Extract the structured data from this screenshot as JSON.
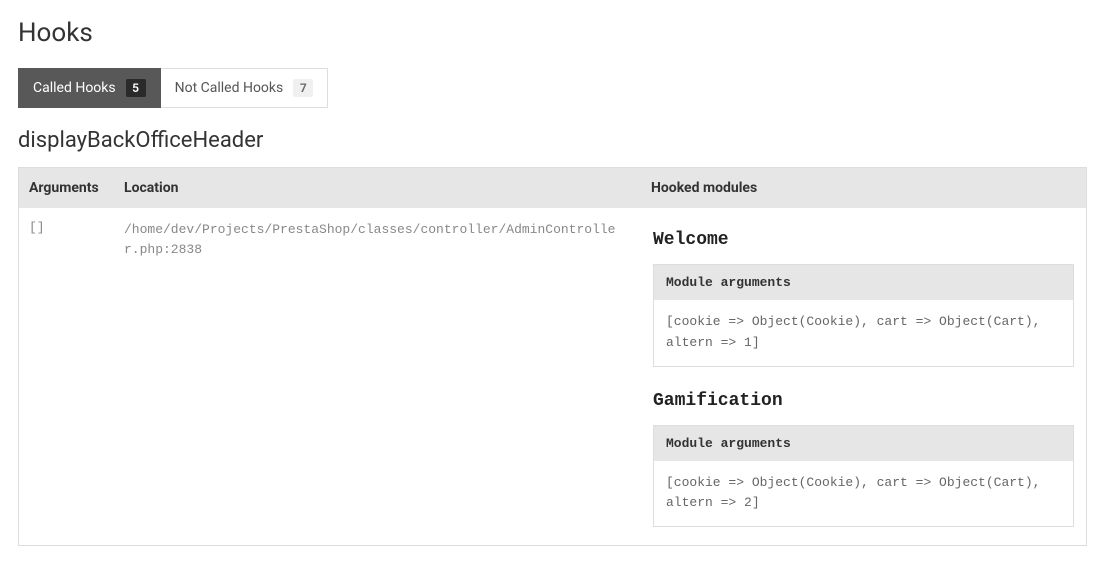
{
  "page_title": "Hooks",
  "tabs": [
    {
      "label": "Called Hooks",
      "count": "5",
      "active": true
    },
    {
      "label": "Not Called Hooks",
      "count": "7",
      "active": false
    }
  ],
  "hook_name": "displayBackOfficeHeader",
  "table": {
    "headers": {
      "arguments": "Arguments",
      "location": "Location",
      "hooked_modules": "Hooked modules"
    },
    "row": {
      "arguments": "[]",
      "location": "/home/dev/Projects/PrestaShop/classes/controller/AdminController.php:2838"
    }
  },
  "modules": [
    {
      "title": "Welcome",
      "args_header": "Module arguments",
      "args_body": "[cookie => Object(Cookie), cart => Object(Cart), altern => 1]"
    },
    {
      "title": "Gamification",
      "args_header": "Module arguments",
      "args_body": "[cookie => Object(Cookie), cart => Object(Cart), altern => 2]"
    }
  ]
}
